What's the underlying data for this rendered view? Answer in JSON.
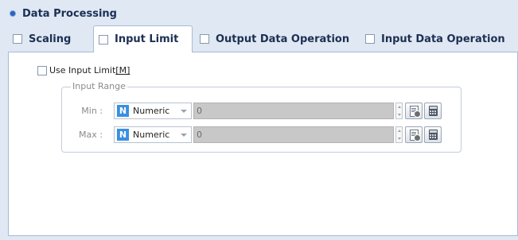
{
  "section": {
    "title": "Data Processing"
  },
  "tabs": [
    {
      "label": "Scaling",
      "checked": false,
      "active": false
    },
    {
      "label": "Input Limit",
      "checked": false,
      "active": true
    },
    {
      "label": "Output Data Operation",
      "checked": false,
      "active": false
    },
    {
      "label": "Input Data Operation",
      "checked": false,
      "active": false
    }
  ],
  "input_limit": {
    "use_label": "Use Input Limit",
    "use_shortcut": "[M]",
    "use_checked": false,
    "group_title": "Input Range",
    "rows": [
      {
        "label": "Min :",
        "type_icon": "N",
        "type": "Numeric",
        "value": "0"
      },
      {
        "label": "Max :",
        "type_icon": "N",
        "type": "Numeric",
        "value": "0"
      }
    ]
  },
  "icons": {
    "section_bullet": "bullet-dot-icon",
    "type": "numeric-type-icon",
    "variable": "variable-browse-icon",
    "calculator": "calculator-icon"
  },
  "colors": {
    "background": "#dfe8f3",
    "panel": "#ffffff",
    "accent": "#3a8fe0",
    "disabled_field": "#c8c8c8"
  }
}
